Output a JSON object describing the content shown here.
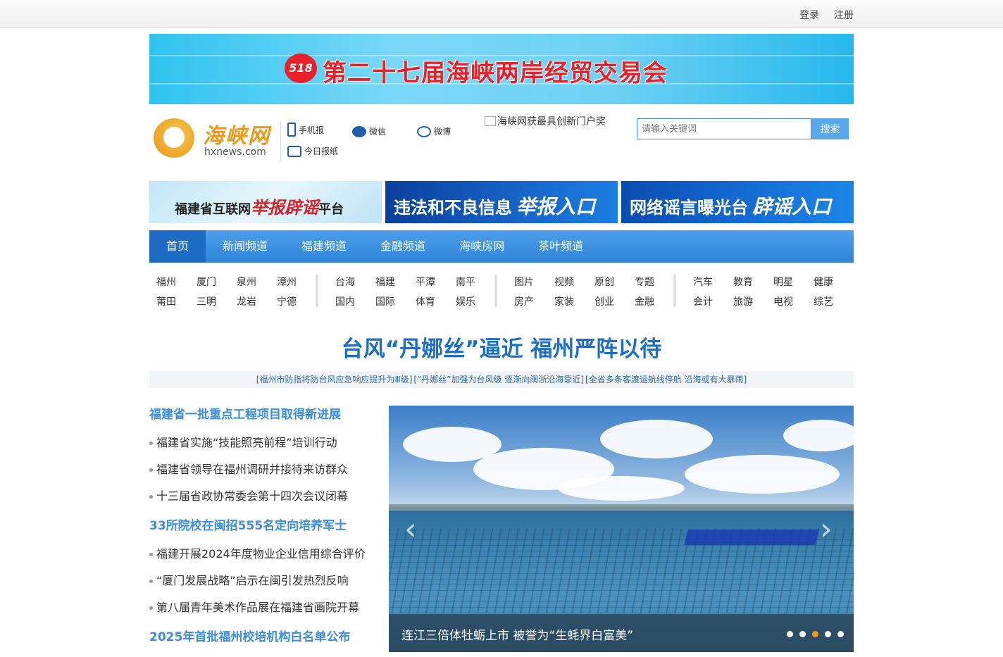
{
  "topbar": {
    "login": "登录",
    "register": "注册"
  },
  "banner": {
    "title": "第二十七届海峡两岸经贸交易会",
    "seal": "518"
  },
  "logo": {
    "cn": "海峡网",
    "en": "hxnews.com"
  },
  "quick_links": {
    "mobile": "手机报",
    "wechat": "微信",
    "weibo": "微博",
    "paper": "今日报纸"
  },
  "award": {
    "alt": "海峡网获最具创新门户奖"
  },
  "search": {
    "placeholder": "请输入关键词",
    "button": "搜索"
  },
  "promos": {
    "p1_pre": "福建省互联网",
    "p1_hl": "举报辟谣",
    "p1_post": "平台",
    "p2_main": "违法和不良信息",
    "p2_hl": "举报入口",
    "p3_main": "网络谣言曝光台",
    "p3_hl": "辟谣入口"
  },
  "nav": [
    "首页",
    "新闻频道",
    "福建频道",
    "金融频道",
    "海峡房网",
    "茶叶频道"
  ],
  "subnav": [
    [
      "福州",
      "厦门",
      "泉州",
      "漳州",
      "莆田",
      "三明",
      "龙岩",
      "宁德"
    ],
    [
      "台海",
      "福建",
      "平潭",
      "南平",
      "国内",
      "国际",
      "体育",
      "娱乐"
    ],
    [
      "图片",
      "视频",
      "原创",
      "专题",
      "房产",
      "家装",
      "创业",
      "金融"
    ],
    [
      "汽车",
      "教育",
      "明星",
      "健康",
      "会计",
      "旅游",
      "电视",
      "综艺"
    ]
  ],
  "headline": "台风“丹娜丝”逼近 福州严阵以待",
  "subheads": [
    "[福州市防指将防台风应急响应提升为Ⅲ级]",
    "[“丹娜丝”加强为台风级 逐渐向闽浙沿海靠近]",
    "[全省多条客渡运航线停航 沿海或有大暴雨]"
  ],
  "news": [
    {
      "type": "h",
      "text": "福建省一批重点工程项目取得新进展"
    },
    {
      "type": "i",
      "text": "福建省实施“技能照亮前程”培训行动"
    },
    {
      "type": "i",
      "text": "福建省领导在福州调研并接待来访群众"
    },
    {
      "type": "i",
      "text": "十三届省政协常委会第十四次会议闭幕"
    },
    {
      "type": "h",
      "text": "33所院校在闽招555名定向培养军士"
    },
    {
      "type": "i",
      "text": "福建开展2024年度物业企业信用综合评价"
    },
    {
      "type": "i",
      "text": "“厦门发展战略”启示在闽引发热烈反响"
    },
    {
      "type": "i",
      "text": "第八届青年美术作品展在福建省画院开幕"
    },
    {
      "type": "h",
      "text": "2025年首批福州校培机构白名单公布"
    }
  ],
  "slider": {
    "caption": "连江三倍体牡蛎上市  被誉为“生蚝界白富美”",
    "prev": "‹",
    "next": "›",
    "active_index": 2,
    "count": 5
  }
}
